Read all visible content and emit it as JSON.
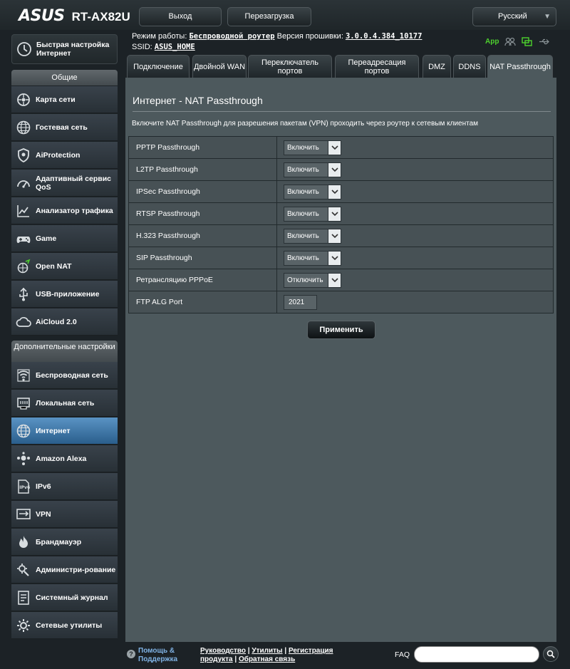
{
  "header": {
    "brand": "ASUS",
    "model": "RT-AX82U",
    "logout_label": "Выход",
    "reboot_label": "Перезагрузка",
    "language": "Русский"
  },
  "info": {
    "mode_label": "Режим работы:",
    "mode_value": "Беспроводной роутер",
    "firmware_label": "Версия прошивки:",
    "firmware_value": "3.0.0.4.384_10177",
    "ssid_label": "SSID:",
    "ssid_value": "ASUS_HOME",
    "app_label": "App"
  },
  "sidebar": {
    "quick_setup": "Быстрая настройка Интернет",
    "general_header": "Общие",
    "general": [
      {
        "label": "Карта сети",
        "icon": "network-map-icon"
      },
      {
        "label": "Гостевая сеть",
        "icon": "globe-icon"
      },
      {
        "label": "AiProtection",
        "icon": "shield-icon"
      },
      {
        "label": "Адаптивный сервис QoS",
        "icon": "gauge-icon"
      },
      {
        "label": "Анализатор трафика",
        "icon": "chart-icon"
      },
      {
        "label": "Game",
        "icon": "gamepad-icon"
      },
      {
        "label": "Open NAT",
        "icon": "open-nat-icon"
      },
      {
        "label": "USB-приложение",
        "icon": "usb-icon"
      },
      {
        "label": "AiCloud 2.0",
        "icon": "cloud-icon"
      }
    ],
    "advanced_header": "Дополнительные настройки",
    "advanced": [
      {
        "label": "Беспроводная сеть",
        "icon": "wifi-icon"
      },
      {
        "label": "Локальная сеть",
        "icon": "lan-icon"
      },
      {
        "label": "Интернет",
        "icon": "globe-icon",
        "active": true
      },
      {
        "label": "Amazon Alexa",
        "icon": "alexa-icon"
      },
      {
        "label": "IPv6",
        "icon": "ipv6-icon"
      },
      {
        "label": "VPN",
        "icon": "vpn-icon"
      },
      {
        "label": "Брандмауэр",
        "icon": "firewall-icon"
      },
      {
        "label": "Администри-рование",
        "icon": "admin-icon"
      },
      {
        "label": "Системный журнал",
        "icon": "log-icon"
      },
      {
        "label": "Сетевые утилиты",
        "icon": "tools-icon"
      }
    ]
  },
  "tabs": [
    {
      "label": "Подключение"
    },
    {
      "label": "Двойной WAN"
    },
    {
      "label": "Переключатель портов"
    },
    {
      "label": "Переадресация портов"
    },
    {
      "label": "DMZ"
    },
    {
      "label": "DDNS"
    },
    {
      "label": "NAT Passthrough",
      "active": true
    }
  ],
  "content": {
    "title": "Интернет - NAT Passthrough",
    "description": "Включите NAT Passthrough для разрешения пакетам (VPN) проходить через роутер к сетевым клиентам",
    "rows": [
      {
        "name": "PPTP Passthrough",
        "value": "Включить",
        "type": "select"
      },
      {
        "name": "L2TP Passthrough",
        "value": "Включить",
        "type": "select"
      },
      {
        "name": "IPSec Passthrough",
        "value": "Включить",
        "type": "select"
      },
      {
        "name": "RTSP Passthrough",
        "value": "Включить",
        "type": "select"
      },
      {
        "name": "H.323 Passthrough",
        "value": "Включить",
        "type": "select"
      },
      {
        "name": "SIP Passthrough",
        "value": "Включить",
        "type": "select"
      },
      {
        "name": "Ретрансляцию PPPoE",
        "value": "Отключить",
        "type": "select"
      },
      {
        "name": "FTP ALG Port",
        "value": "2021",
        "type": "text"
      }
    ],
    "apply_label": "Применить"
  },
  "footer": {
    "help_label": "Помощь & Поддержка",
    "links": [
      "Руководство",
      "Утилиты",
      "Регистрация продукта",
      "Обратная связь"
    ],
    "faq_label": "FAQ"
  },
  "colors": {
    "background": "#1c2226",
    "panel": "#4d595d",
    "active_menu": "#3f78ab",
    "app_green": "#4ed22e",
    "help_link": "#7fb2e4"
  }
}
